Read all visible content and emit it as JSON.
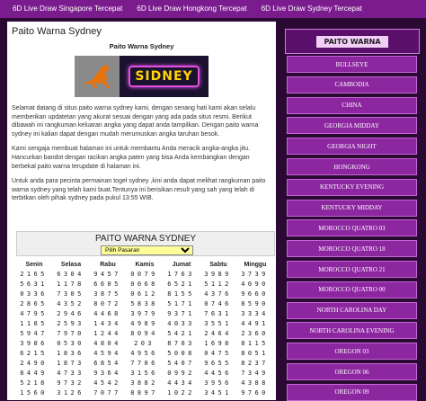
{
  "topnav": {
    "links": [
      "6D Live Draw Singapore Tercepat",
      "6D Live Draw Hongkong Tercepat",
      "6D Live Draw Sydney Tercepat"
    ]
  },
  "article": {
    "title": "Paito Warna Sydney",
    "subtitle": "Paito Warna Sydney",
    "banner_text": "SIDNEY",
    "paragraphs": [
      "Selamat datang di situs paito warna sydney kami, dengan senang hati kami akan selalu memberikan updatetan yang akurat sesuai dengan yang ada pada situs resmi. Berikut dibawah ini rangkuman keluaran angka yang dapat anda tampilkan. Dengan paito warna sydney ini kalian dapat dengan mudah merumuskan angka taruhan besok.",
      "Kami sengaja membuat halaman ini untuk membantu Anda meracik angka-angka jitu. Hancurkan bandot dengan racikan angka paten yang bisa Anda kembangkan dengan berbekal paito warna terupdate di halaman ini.",
      "Untuk anda para pecinta permainan togel sydney ,kini anda dapat melihat rangkuman paito warna sydney yang telah kami buat.Tentunya ini berisikan result yang sah yang telah di terbitkan oleh pihak sydney pada pukul 13:55 WIB."
    ]
  },
  "paito": {
    "title": "PAITO WARNA SYDNEY",
    "select_value": "Pilih Pasaran",
    "days": [
      "Senin",
      "Selasa",
      "Rabu",
      "Kamis",
      "Jumat",
      "Sabtu",
      "Minggu"
    ],
    "rows": [
      [
        "2165",
        "6304",
        "9457",
        "0079",
        "1763",
        "3989",
        "3739"
      ],
      [
        "5631",
        "1178",
        "6605",
        "0068",
        "6521",
        "5112",
        "4090"
      ],
      [
        "0336",
        "7305",
        "3875",
        "0612",
        "8155",
        "4376",
        "9660"
      ],
      [
        "2865",
        "4352",
        "8072",
        "5838",
        "5171",
        "0746",
        "8590"
      ],
      [
        "4795",
        "2946",
        "4468",
        "3979",
        "9371",
        "7631",
        "3334"
      ],
      [
        "1185",
        "2593",
        "1434",
        "4989",
        "4033",
        "3551",
        "4491"
      ],
      [
        "5947",
        "7970",
        "1244",
        "8094",
        "5421",
        "2464",
        "2360"
      ],
      [
        "3986",
        "0530",
        "4804",
        "203",
        "8703",
        "1698",
        "8115"
      ],
      [
        "6215",
        "1836",
        "4594",
        "4956",
        "5008",
        "0475",
        "8051"
      ],
      [
        "2490",
        "1873",
        "6854",
        "7706",
        "5407",
        "9655",
        "8237"
      ],
      [
        "8449",
        "4733",
        "9364",
        "3156",
        "0992",
        "4456",
        "7349"
      ],
      [
        "5218",
        "9732",
        "4542",
        "3882",
        "4434",
        "3956",
        "4388"
      ],
      [
        "1560",
        "3126",
        "7077",
        "8897",
        "1022",
        "3451",
        "9760"
      ]
    ]
  },
  "sidebar": {
    "title": "PAITO WARNA",
    "items": [
      "BULLSEYE",
      "CAMBODIA",
      "CHINA",
      "GEORGIA MIDDAY",
      "GEORGIA NIGHT",
      "HONGKONG",
      "KENTUCKY EVENING",
      "KENTUCKY MIDDAY",
      "MOROCCO QUATRO 03",
      "MOROCCO QUATRO 18",
      "MOROCCO QUATRO 21",
      "MOROCCO QUATRO 00",
      "NORTH CAROLINA DAY",
      "NORTH CAROLINA EVENING",
      "OREGON 03",
      "OREGON 06",
      "OREGON 09"
    ]
  }
}
